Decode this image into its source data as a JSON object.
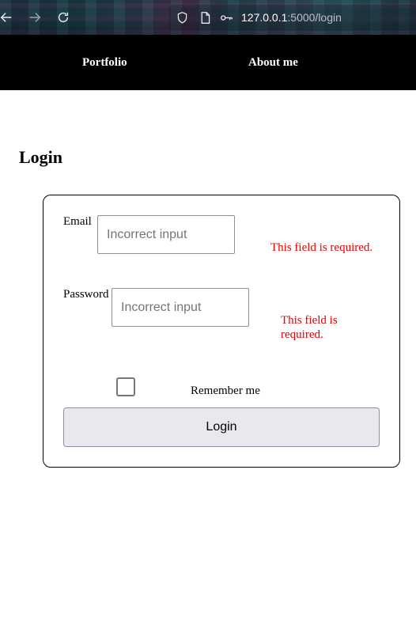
{
  "browser": {
    "url_host": "127.0.0.1",
    "url_rest": ":5000/login",
    "icons": [
      "back-arrow-icon",
      "forward-arrow-icon",
      "reload-icon",
      "shield-icon",
      "page-icon",
      "key-icon"
    ]
  },
  "nav": {
    "portfolio": "Portfolio",
    "about": "About me"
  },
  "page": {
    "title": "Login"
  },
  "form": {
    "email_label": "Email",
    "email_placeholder": "Incorrect input",
    "email_error": "This field is required.",
    "password_label": "Password",
    "password_placeholder": "Incorrect input",
    "password_error": "This field is required.",
    "remember_label": "Remember me",
    "remember_checked": false,
    "submit_label": "Login"
  },
  "colors": {
    "error": "#e60000",
    "nav_bg": "#000000",
    "button_bg": "#e9e9ed"
  }
}
